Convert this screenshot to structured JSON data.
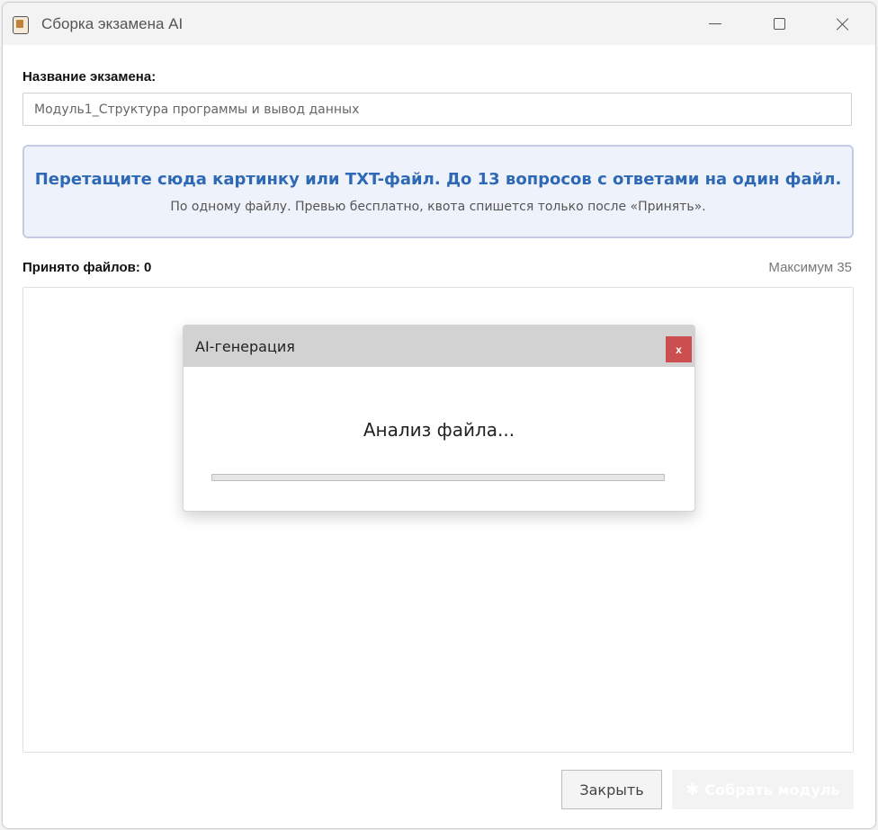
{
  "window": {
    "title": "Сборка экзамена AI",
    "icon": "exam-app-icon"
  },
  "exam": {
    "label": "Название экзамена:",
    "value": "Модуль1_Структура программы и вывод данных"
  },
  "dropzone": {
    "title": "Перетащите сюда картинку или TXT-файл. До 13 вопросов с ответами на один файл.",
    "subtitle": "По одному файлу. Превью бесплатно, квота спишется только после «Принять»."
  },
  "files": {
    "accepted_label": "Принято файлов: 0",
    "max_label": "Максимум 35"
  },
  "buttons": {
    "close": "Закрыть",
    "build": "Собрать модуль",
    "build_icon": "puzzle-icon"
  },
  "modal": {
    "title": "AI-генерация",
    "close_label": "x",
    "status": "Анализ файла...",
    "progress": 0
  },
  "colors": {
    "accent_text": "#2f69b5",
    "dropzone_bg": "#eef3fb",
    "modal_close_bg": "#cc4e4e"
  }
}
